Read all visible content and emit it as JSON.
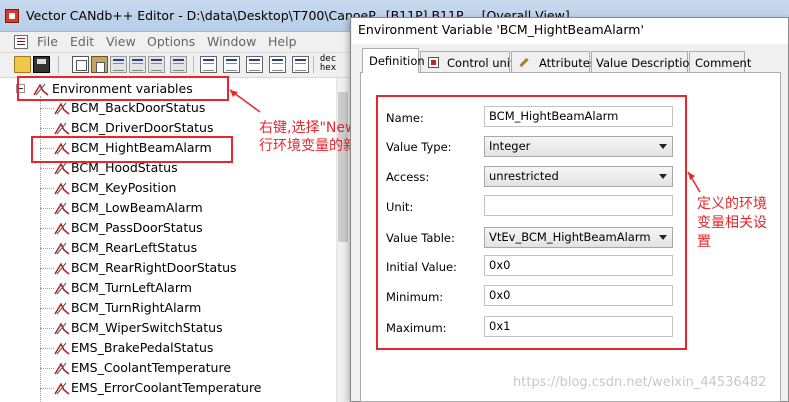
{
  "main_window": {
    "title": "Vector CANdb++ Editor - D:\\data\\Desktop\\T700\\CanoeP...[B11P] B11P_...[Overall View]",
    "menu": [
      "File",
      "Edit",
      "View",
      "Options",
      "Window",
      "Help"
    ],
    "toolbar": {
      "dec_label": "dec",
      "hex_label": "hex"
    }
  },
  "tree": {
    "root_label": "Environment variables",
    "items": [
      "BCM_BackDoorStatus",
      "BCM_DriverDoorStatus",
      "BCM_HightBeamAlarm",
      "BCM_HoodStatus",
      "BCM_KeyPosition",
      "BCM_LowBeamAlarm",
      "BCM_PassDoorStatus",
      "BCM_RearLeftStatus",
      "BCM_RearRightDoorStatus",
      "BCM_TurnLeftAlarm",
      "BCM_TurnRightAlarm",
      "BCM_WiperSwitchStatus",
      "EMS_BrakePedalStatus",
      "EMS_CoolantTemperature",
      "EMS_ErrorCoolantTemperature"
    ],
    "selected_index": 2
  },
  "annotations": {
    "right_click_line1": "右键,选择\"New\"进",
    "right_click_line2": "行环境变量的新建",
    "define_line1": "定义的环境",
    "define_line2": "变量相关设",
    "define_line3": "置"
  },
  "dialog": {
    "title": "Environment Variable 'BCM_HightBeamAlarm'",
    "tabs": [
      "Definition",
      "Control units",
      "Attributes",
      "Value Descriptions",
      "Comment"
    ],
    "active_tab": 0,
    "fields": {
      "name_label": "Name:",
      "name_value": "BCM_HightBeamAlarm",
      "value_type_label": "Value Type:",
      "value_type_value": "Integer",
      "access_label": "Access:",
      "access_value": "unrestricted",
      "unit_label": "Unit:",
      "unit_value": "",
      "value_table_label": "Value Table:",
      "value_table_value": "VtEv_BCM_HightBeamAlarm",
      "initial_label": "Initial Value:",
      "initial_value": "0x0",
      "minimum_label": "Minimum:",
      "minimum_value": "0x0",
      "maximum_label": "Maximum:",
      "maximum_value": "0x1"
    }
  },
  "watermark": "https://blog.csdn.net/weixin_44536482",
  "colors": {
    "annotation_red": "#e8262c",
    "title_bar": "#c9d9ee"
  }
}
